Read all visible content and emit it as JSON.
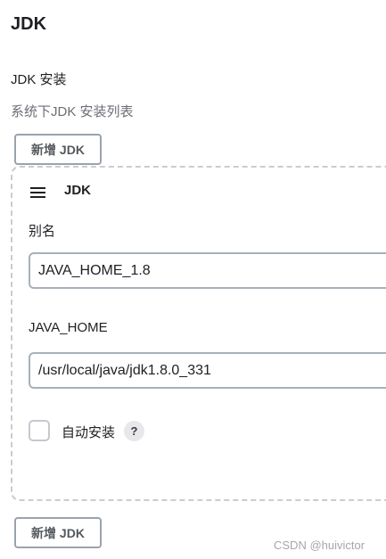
{
  "section": {
    "title": "JDK",
    "subhead": "JDK 安装",
    "description": "系统下JDK 安装列表"
  },
  "buttons": {
    "add_top": "新增 JDK",
    "add_bottom": "新增 JDK"
  },
  "card": {
    "title": "JDK",
    "handle_icon": "drag-handle-icon",
    "alias_label": "别名",
    "alias_value": "JAVA_HOME_1.8",
    "home_label": "JAVA_HOME",
    "home_value": "/usr/local/java/jdk1.8.0_331",
    "auto_install_label": "自动安装",
    "auto_install_checked": false,
    "help_symbol": "?"
  },
  "watermark": "CSDN @huivictor"
}
